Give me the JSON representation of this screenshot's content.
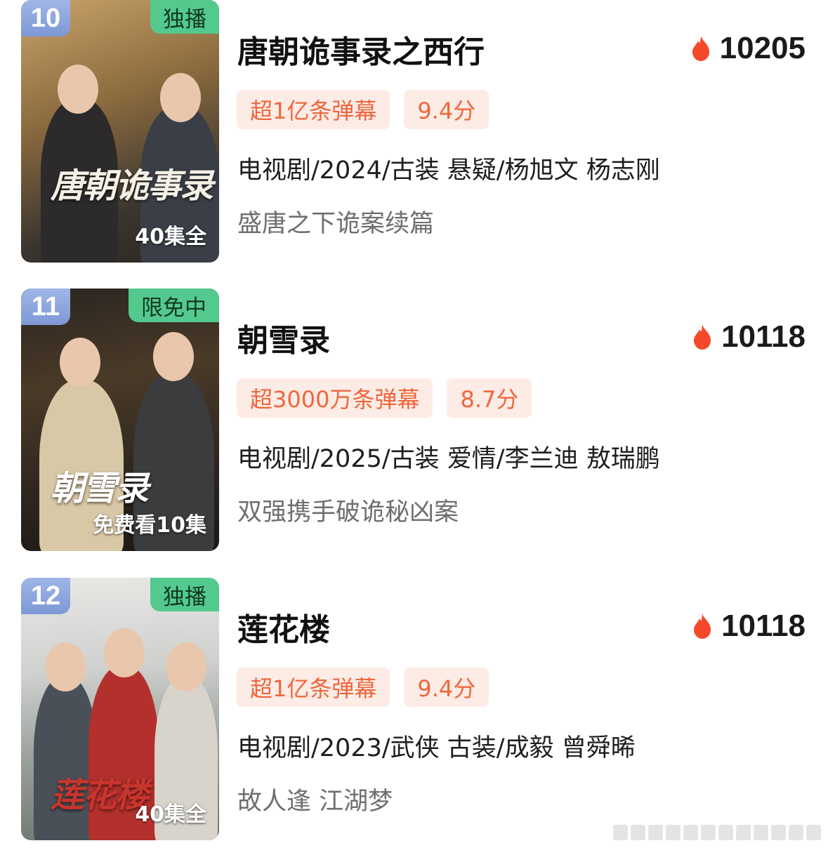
{
  "items": [
    {
      "rank": "10",
      "badge": "独播",
      "poster_caption": "40集全",
      "poster_logo": "唐朝诡事录",
      "title": "唐朝诡事录之西行",
      "heat": "10205",
      "tags": [
        "超1亿条弹幕",
        "9.4分"
      ],
      "meta": "电视剧/2024/古装 悬疑/杨旭文 杨志刚",
      "desc": "盛唐之下诡案续篇"
    },
    {
      "rank": "11",
      "badge": "限免中",
      "poster_caption": "免费看10集",
      "poster_logo": "朝雪录",
      "title": "朝雪录",
      "heat": "10118",
      "tags": [
        "超3000万条弹幕",
        "8.7分"
      ],
      "meta": "电视剧/2025/古装 爱情/李兰迪 敖瑞鹏",
      "desc": "双强携手破诡秘凶案"
    },
    {
      "rank": "12",
      "badge": "独播",
      "poster_caption": "40集全",
      "poster_logo": "莲花楼",
      "title": "莲花楼",
      "heat": "10118",
      "tags": [
        "超1亿条弹幕",
        "9.4分"
      ],
      "meta": "电视剧/2023/武侠 古装/成毅 曾舜晞",
      "desc": "故人逢 江湖梦"
    }
  ],
  "colors": {
    "rank_badge": "#8aa3dc",
    "exclusive_badge": "#54c98e",
    "tag_bg": "#fdece6",
    "tag_text": "#f0663c",
    "flame": "#f5492c"
  },
  "icons": {
    "heat": "flame-icon"
  }
}
